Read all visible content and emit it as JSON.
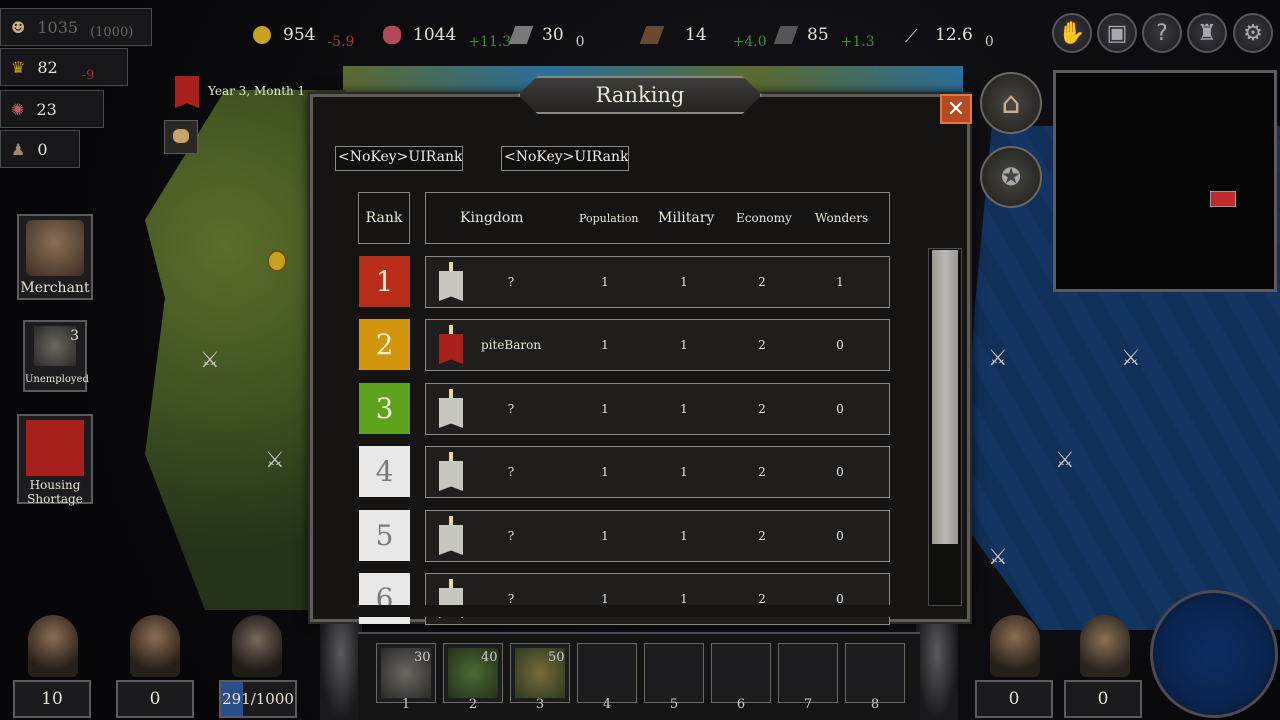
{
  "topbar": {
    "resources": [
      {
        "icon": "gold-coin-icon",
        "value": "954",
        "delta": "-5.9",
        "tone": "neg"
      },
      {
        "icon": "meat-icon",
        "value": "1044",
        "delta": "+11.3",
        "tone": "pos"
      },
      {
        "icon": "stone-icon",
        "value": "30",
        "delta": "0",
        "tone": "zer"
      },
      {
        "icon": "wood-icon",
        "value": "14",
        "delta": "+4.0",
        "tone": "pos"
      },
      {
        "icon": "iron-icon",
        "value": "85",
        "delta": "+1.3",
        "tone": "pos"
      },
      {
        "icon": "sword-icon",
        "value": "12.6",
        "delta": "0",
        "tone": "zer"
      }
    ]
  },
  "left_stats": {
    "population": {
      "value": "1035",
      "max": "(1000)"
    },
    "happiness": {
      "value": "82",
      "delta": "-9"
    },
    "stat3": {
      "value": "23"
    },
    "stat4": {
      "value": "0"
    },
    "date": "Year 3, Month 1"
  },
  "left_buttons": {
    "merchant": "Merchant",
    "unemployed": "Unemployed",
    "unemployed_count": "3",
    "housing": "Housing Shortage"
  },
  "dialog": {
    "title": "Ranking",
    "close": "✕",
    "tab1": "<NoKey>UIRankin",
    "tab2": "<NoKey>UIRankin",
    "headers": {
      "rank": "Rank",
      "kingdom": "Kingdom",
      "population": "Population",
      "military": "Military",
      "economy": "Economy",
      "wonders": "Wonders"
    },
    "rows": [
      {
        "rank": "1",
        "name": "?",
        "population": "1",
        "military": "1",
        "economy": "2",
        "wonders": "1"
      },
      {
        "rank": "2",
        "name": "piteBaron",
        "population": "1",
        "military": "1",
        "economy": "2",
        "wonders": "0"
      },
      {
        "rank": "3",
        "name": "?",
        "population": "1",
        "military": "1",
        "economy": "2",
        "wonders": "0"
      },
      {
        "rank": "4",
        "name": "?",
        "population": "1",
        "military": "1",
        "economy": "2",
        "wonders": "0"
      },
      {
        "rank": "5",
        "name": "?",
        "population": "1",
        "military": "1",
        "economy": "2",
        "wonders": "0"
      },
      {
        "rank": "6",
        "name": "?",
        "population": "1",
        "military": "1",
        "economy": "2",
        "wonders": "0"
      }
    ],
    "rank_colors": [
      "#b82e1a",
      "#d2960e",
      "#5ea21e",
      "#e8e8e8",
      "#e8e8e8",
      "#e8e8e8"
    ]
  },
  "bottom": {
    "counts": {
      "c1": "10",
      "c2": "0",
      "c3": "291/1000",
      "c4": "0",
      "c5": "0"
    },
    "army_progress": 0.291,
    "slots": [
      {
        "num": "1",
        "count": "30"
      },
      {
        "num": "2",
        "count": "40"
      },
      {
        "num": "3",
        "count": "50"
      },
      {
        "num": "4",
        "count": ""
      },
      {
        "num": "5",
        "count": ""
      },
      {
        "num": "6",
        "count": ""
      },
      {
        "num": "7",
        "count": ""
      },
      {
        "num": "8",
        "count": ""
      }
    ]
  }
}
